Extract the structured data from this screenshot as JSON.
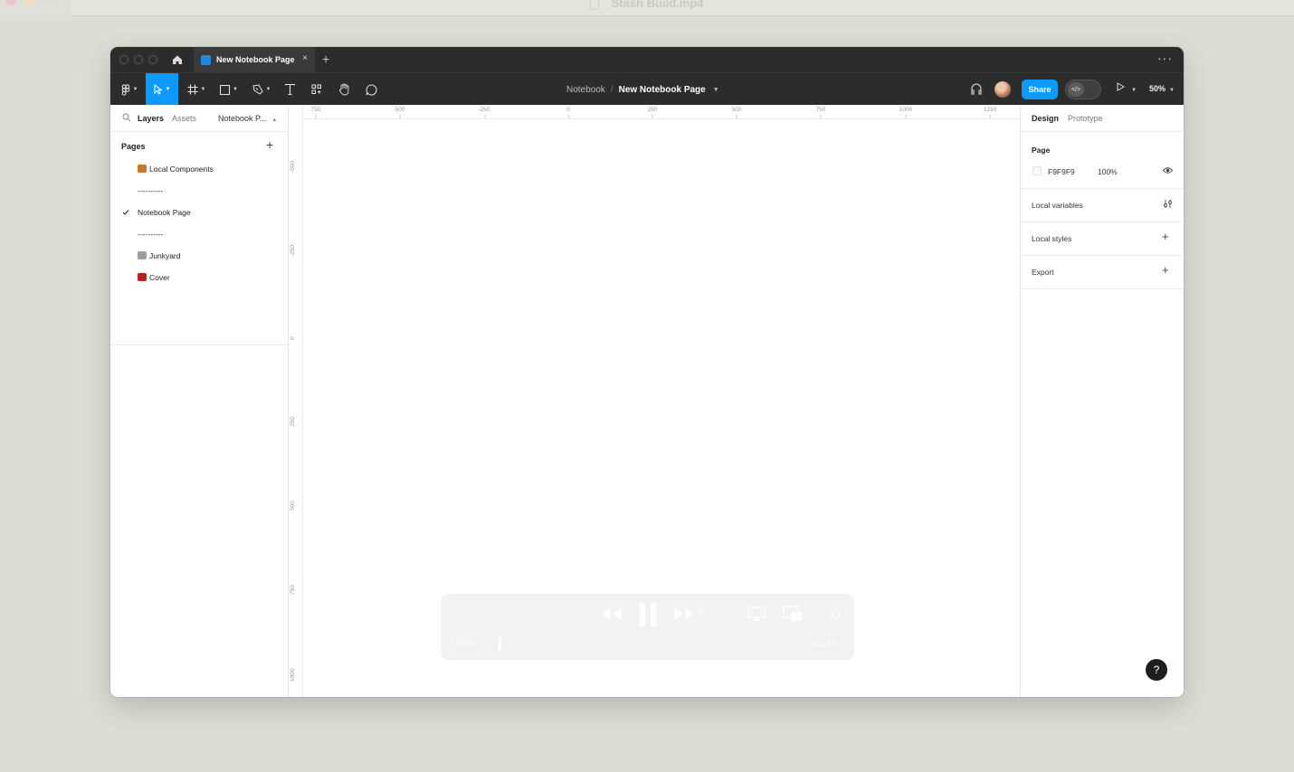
{
  "os": {
    "title": "_Stash Build.mp4"
  },
  "window": {
    "tab": {
      "label": "New Notebook Page",
      "close": "×"
    },
    "new_tab": "+",
    "more": "···"
  },
  "toolbar": {
    "breadcrumb_parent": "Notebook",
    "breadcrumb_sep": "/",
    "breadcrumb_current": "New Notebook Page",
    "share_label": "Share",
    "dev_mode_label": "</>",
    "zoom": "50%"
  },
  "left_panel": {
    "tab_layers": "Layers",
    "tab_assets": "Assets",
    "page_selector": "Notebook P...",
    "pages_header": "Pages",
    "add_page": "+",
    "pages": [
      {
        "label": "Local Components",
        "emoji_color": "#c9772f"
      },
      {
        "label": "----------"
      },
      {
        "label": "Notebook Page",
        "selected": true
      },
      {
        "label": "----------"
      },
      {
        "label": "Junkyard",
        "emoji_color": "#9aa0a6"
      },
      {
        "label": "Cover",
        "emoji_color": "#b3261e"
      }
    ]
  },
  "rulers": {
    "horizontal": [
      "-750",
      "-500",
      "-250",
      "0",
      "250",
      "500",
      "750",
      "1000",
      "1250"
    ],
    "vertical": [
      "-500",
      "-250",
      "0",
      "250",
      "500",
      "750",
      "1000"
    ]
  },
  "right_panel": {
    "tab_design": "Design",
    "tab_prototype": "Prototype",
    "page_title": "Page",
    "page_color_hex": "F9F9F9",
    "page_opacity": "100%",
    "local_variables": "Local variables",
    "local_styles": "Local styles",
    "export": "Export",
    "add": "+"
  },
  "help": "?",
  "video": {
    "current_time": "00:00",
    "total_time": "02:45",
    "skip_label": "10"
  },
  "colors": {
    "accent": "#0d99ff",
    "toolbar_bg": "#2c2c2c",
    "desktop_bg": "#dcded5"
  }
}
